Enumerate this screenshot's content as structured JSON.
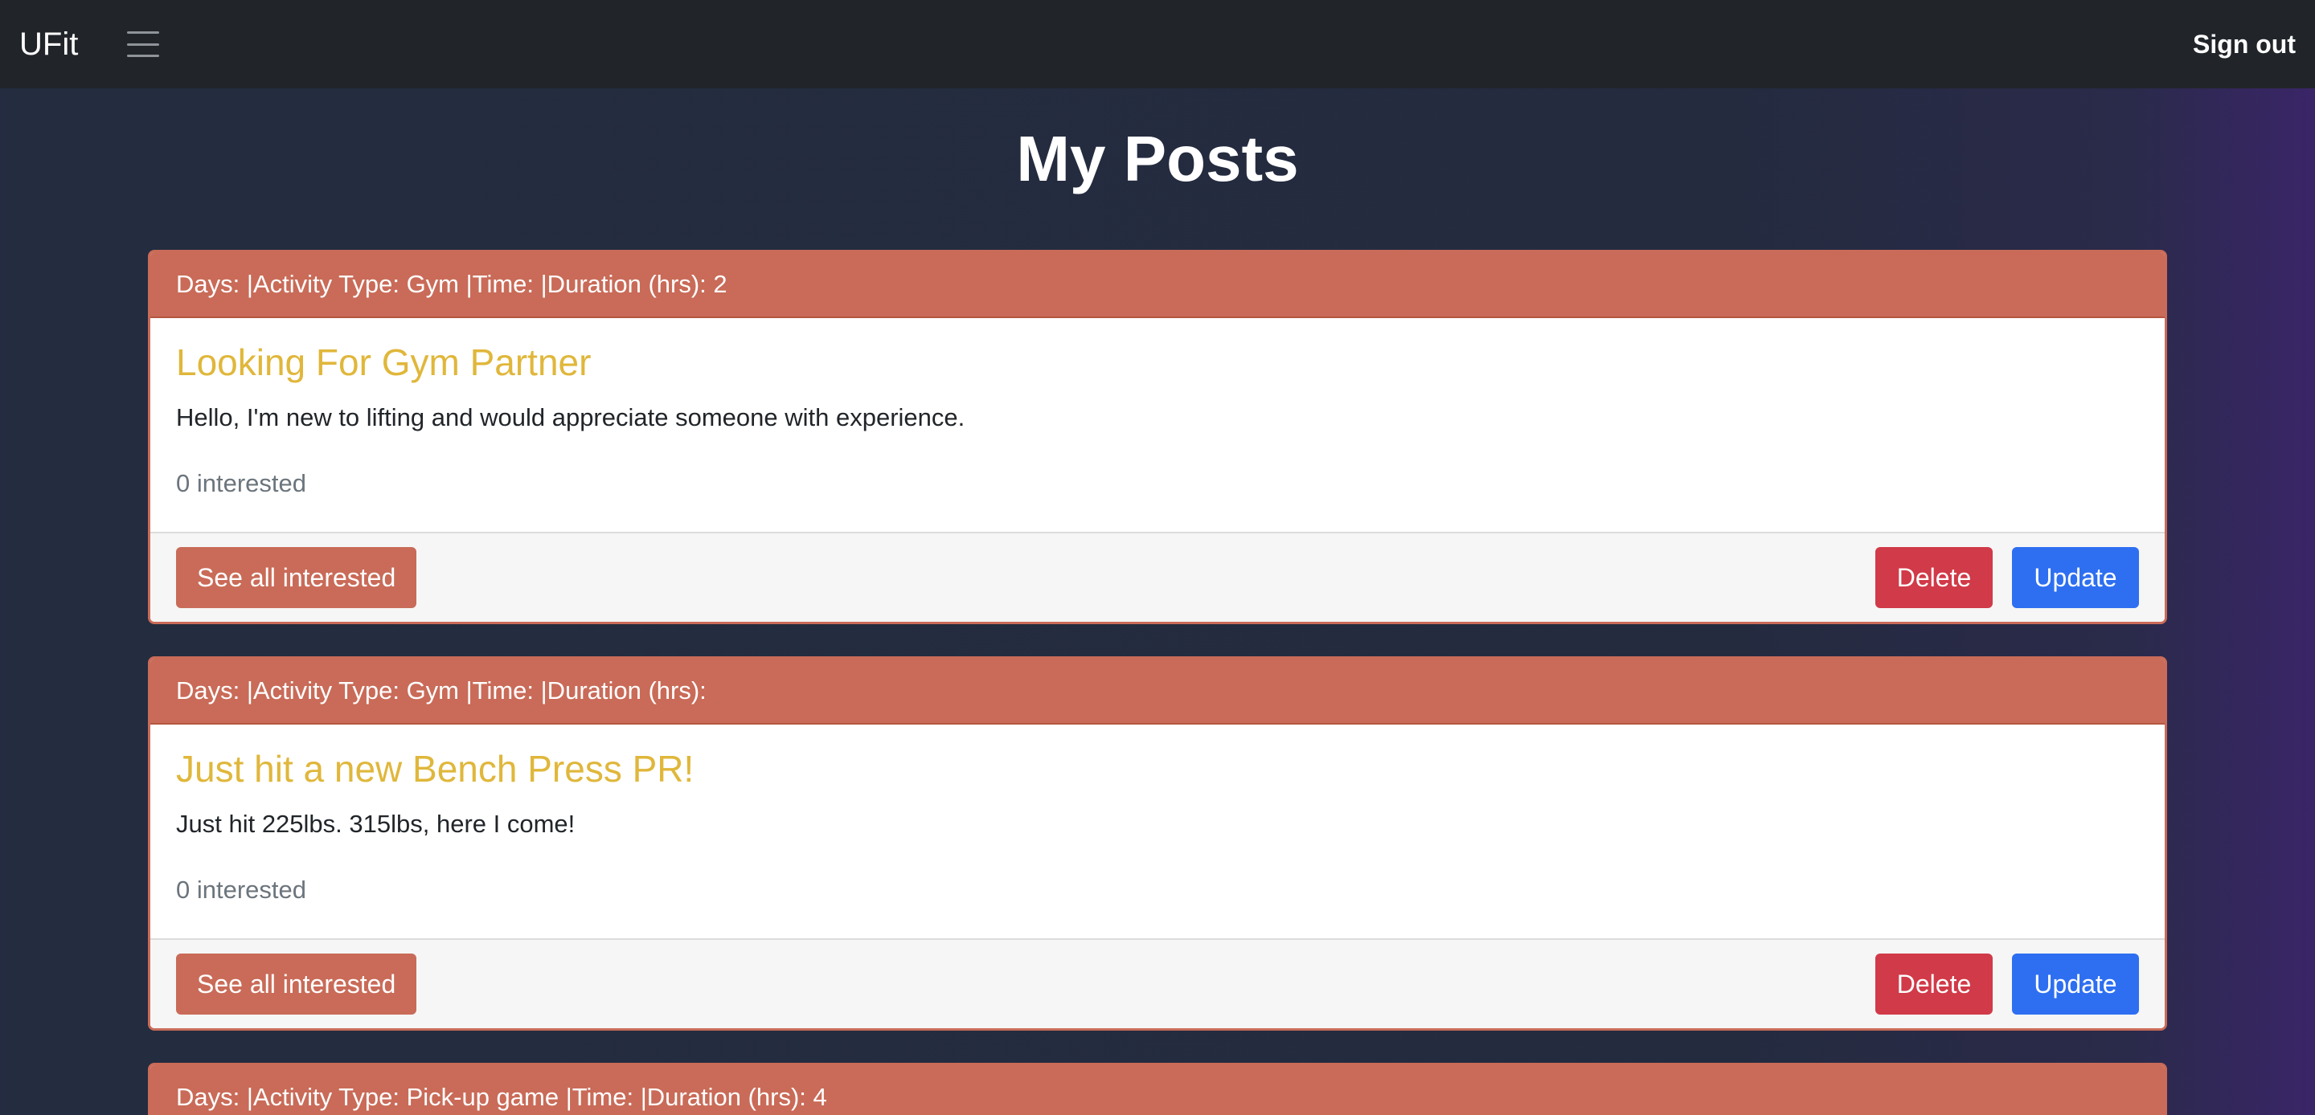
{
  "nav": {
    "brand": "UFit",
    "signout_label": "Sign out"
  },
  "page_title": "My Posts",
  "posts": [
    {
      "header": "Days: |Activity Type: Gym |Time: |Duration (hrs): 2",
      "title": "Looking For Gym Partner",
      "body": "Hello, I'm new to lifting and would appreciate someone with experience.",
      "interested": "0 interested",
      "see_all_label": "See all interested",
      "delete_label": "Delete",
      "update_label": "Update"
    },
    {
      "header": "Days: |Activity Type: Gym |Time: |Duration (hrs):",
      "title": "Just hit a new Bench Press PR!",
      "body": "Just hit 225lbs. 315lbs, here I come!",
      "interested": "0 interested",
      "see_all_label": "See all interested",
      "delete_label": "Delete",
      "update_label": "Update"
    },
    {
      "header": "Days: |Activity Type: Pick-up game |Time: |Duration (hrs): 4"
    }
  ],
  "colors": {
    "navbar": "#212529",
    "background": "#242c3f",
    "card_accent": "#c96b58",
    "title": "#e0b73b",
    "delete": "#d13a48",
    "update": "#2e6ff1"
  },
  "icons": {
    "menu": "hamburger-menu-icon"
  }
}
